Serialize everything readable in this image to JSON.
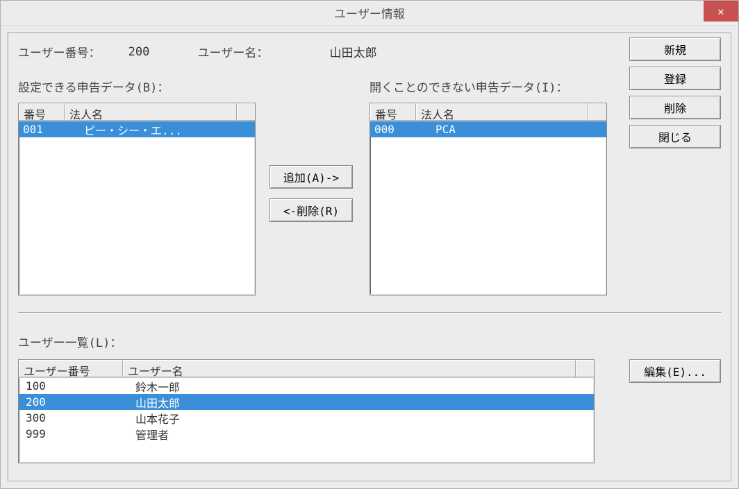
{
  "window": {
    "title": "ユーザー情報"
  },
  "labels": {
    "user_no": "ユーザー番号：",
    "user_name": "ユーザー名：",
    "left_list_title": "設定できる申告データ(B)：",
    "right_list_title": "開くことのできない申告データ(I)：",
    "user_list_title": "ユーザー一覧(L)："
  },
  "values": {
    "user_no": "200",
    "user_name": "山田太郎"
  },
  "columns": {
    "no": "番号",
    "corp": "法人名",
    "user_no": "ユーザー番号",
    "user_name": "ユーザー名"
  },
  "left_list": {
    "rows": [
      {
        "no": "001",
        "name": "ピー・シー・エ...",
        "selected": true
      }
    ]
  },
  "right_list": {
    "rows": [
      {
        "no": "000",
        "name": "PCA",
        "selected": true
      }
    ]
  },
  "user_list": {
    "rows": [
      {
        "no": "100",
        "name": "鈴木一郎",
        "selected": false
      },
      {
        "no": "200",
        "name": "山田太郎",
        "selected": true
      },
      {
        "no": "300",
        "name": "山本花子",
        "selected": false
      },
      {
        "no": "999",
        "name": "管理者",
        "selected": false
      }
    ]
  },
  "buttons": {
    "add": "追加(A)->",
    "remove": "<-削除(R)",
    "new": "新規",
    "register": "登録",
    "delete": "削除",
    "close": "閉じる",
    "edit": "編集(E)..."
  }
}
